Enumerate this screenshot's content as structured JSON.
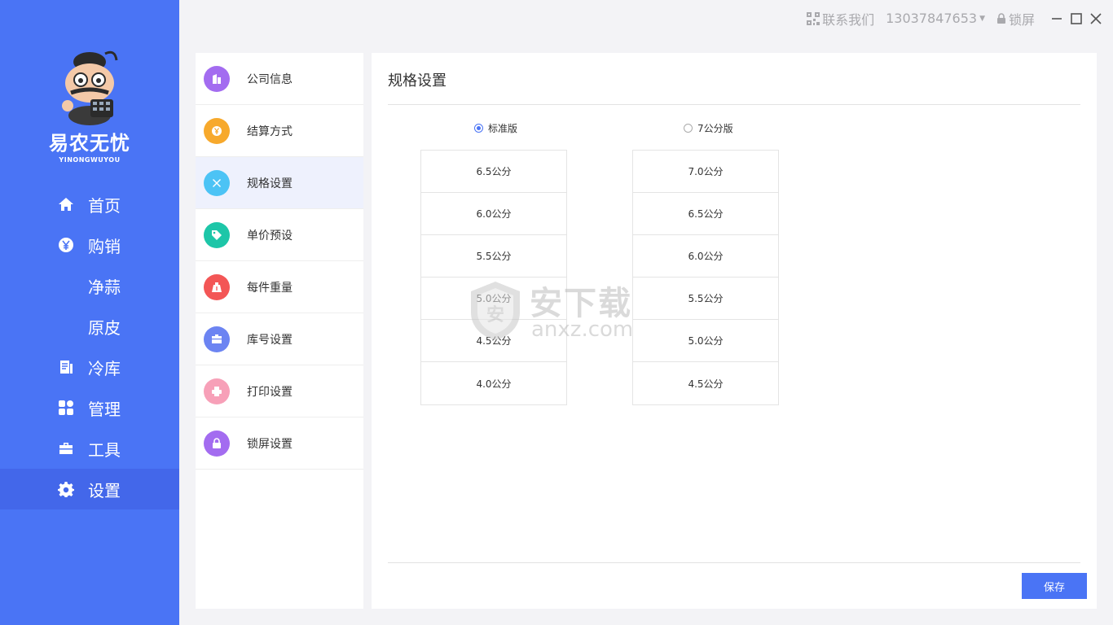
{
  "brand": {
    "name": "易农无忧",
    "sub": "YINONGWUYOU"
  },
  "titlebar": {
    "contact": "联系我们",
    "phone": "13037847653",
    "lock": "锁屏"
  },
  "nav": [
    {
      "label": "首页",
      "icon": "home-icon"
    },
    {
      "label": "购销",
      "icon": "yen-circle-icon"
    },
    {
      "label": "净蒜",
      "icon": ""
    },
    {
      "label": "原皮",
      "icon": ""
    },
    {
      "label": "冷库",
      "icon": "document-icon"
    },
    {
      "label": "管理",
      "icon": "grid-icon"
    },
    {
      "label": "工具",
      "icon": "toolbox-icon"
    },
    {
      "label": "设置",
      "icon": "gear-icon"
    }
  ],
  "settings_menu": [
    {
      "label": "公司信息",
      "icon": "building-icon",
      "color": "#a36cf0"
    },
    {
      "label": "结算方式",
      "icon": "yen-coin-icon",
      "color": "#f7a92c"
    },
    {
      "label": "规格设置",
      "icon": "tools-icon",
      "color": "#4cc3f5"
    },
    {
      "label": "单价预设",
      "icon": "tag-icon",
      "color": "#1dc6a8"
    },
    {
      "label": "每件重量",
      "icon": "weight-icon",
      "color": "#f35656"
    },
    {
      "label": "库号设置",
      "icon": "briefcase-icon",
      "color": "#6c84f2"
    },
    {
      "label": "打印设置",
      "icon": "printer-icon",
      "color": "#f7a0b8"
    },
    {
      "label": "锁屏设置",
      "icon": "lock-icon",
      "color": "#a36cf0"
    }
  ],
  "panel": {
    "title": "规格设置",
    "options": [
      {
        "label": "标准版",
        "checked": true
      },
      {
        "label": "7公分版",
        "checked": false
      }
    ],
    "standard": [
      "6.5公分",
      "6.0公分",
      "5.5公分",
      "5.0公分",
      "4.5公分",
      "4.0公分"
    ],
    "seven": [
      "7.0公分",
      "6.5公分",
      "6.0公分",
      "5.5公分",
      "5.0公分",
      "4.5公分"
    ],
    "save_label": "保存"
  },
  "watermark": {
    "text": "安下载",
    "sub": "anxz.com",
    "badge": "安"
  },
  "colors": {
    "primary": "#4a74f5",
    "active_nav": "#4367ea"
  }
}
